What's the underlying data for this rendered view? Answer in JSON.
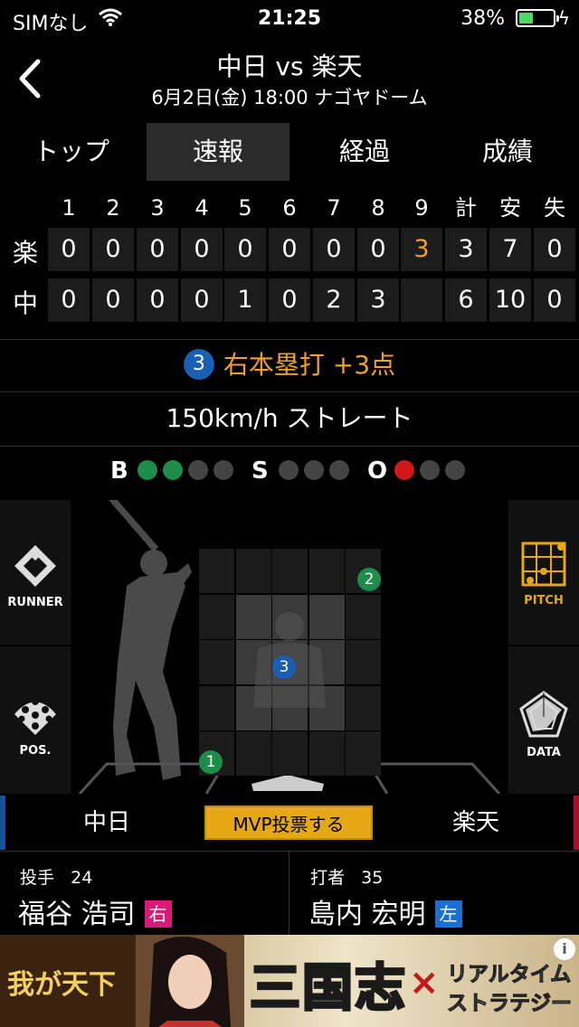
{
  "status": {
    "carrier": "SIMなし",
    "time": "21:25",
    "battery": "38%"
  },
  "header": {
    "title": "中日 vs 楽天",
    "subtitle": "6月2日(金) 18:00 ナゴヤドーム"
  },
  "tabs": [
    {
      "label": "トップ",
      "active": false
    },
    {
      "label": "速報",
      "active": true
    },
    {
      "label": "経過",
      "active": false
    },
    {
      "label": "成績",
      "active": false
    }
  ],
  "scoreboard": {
    "headers": [
      "1",
      "2",
      "3",
      "4",
      "5",
      "6",
      "7",
      "8",
      "9",
      "計",
      "安",
      "失"
    ],
    "rows": [
      {
        "team": "楽",
        "cells": [
          "0",
          "0",
          "0",
          "0",
          "0",
          "0",
          "0",
          "0",
          "3",
          "3",
          "7",
          "0"
        ]
      },
      {
        "team": "中",
        "cells": [
          "0",
          "0",
          "0",
          "0",
          "1",
          "0",
          "2",
          "3",
          "",
          "6",
          "10",
          "0"
        ]
      }
    ]
  },
  "play": {
    "number": "3",
    "text": "右本塁打 +3点"
  },
  "pitch": {
    "text": "150km/h ストレート"
  },
  "count": {
    "b_label": "B",
    "s_label": "S",
    "o_label": "O",
    "balls": 2,
    "strikes": 0,
    "outs": 1
  },
  "side_buttons": {
    "runner": "RUNNER",
    "pos": "POS.",
    "pitch": "PITCH",
    "data": "DATA"
  },
  "pitches": [
    {
      "n": "1"
    },
    {
      "n": "2"
    },
    {
      "n": "3"
    }
  ],
  "teams": {
    "home": "中日",
    "away": "楽天",
    "mvp": "MVP投票する"
  },
  "pitcher": {
    "role": "投手",
    "number": "24",
    "name": "福谷 浩司",
    "hand": "右",
    "hand_color": "#d81b7a"
  },
  "batter": {
    "role": "打者",
    "number": "35",
    "name": "島内 宏明",
    "hand": "左",
    "hand_color": "#1a6fd0"
  },
  "ad": {
    "left": "我が天下",
    "title": "三国志",
    "cross": "×",
    "right1": "リアルタイム",
    "right2": "ストラテジー"
  }
}
